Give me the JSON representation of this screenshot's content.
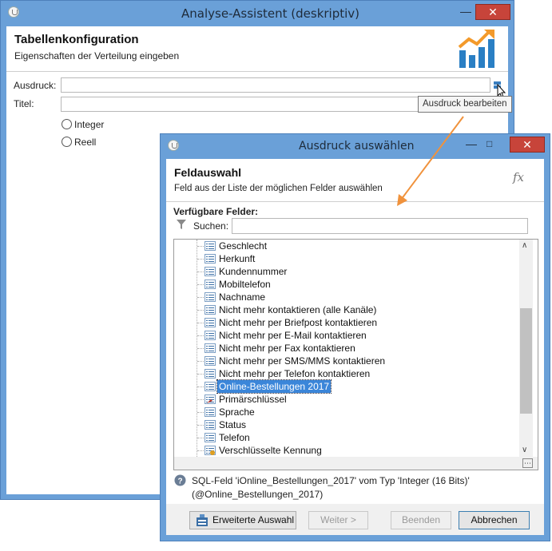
{
  "main_window": {
    "title": "Analyse-Assistent (deskriptiv)",
    "header_title": "Tabellenkonfiguration",
    "header_subtitle": "Eigenschaften der Verteilung eingeben",
    "expression_label": "Ausdruck:",
    "title_label": "Titel:",
    "radio_integer": "Integer",
    "radio_real": "Reell",
    "tooltip": "Ausdruck bearbeiten"
  },
  "dialog": {
    "title": "Ausdruck auswählen",
    "header_title": "Feldauswahl",
    "header_subtitle": "Feld aus der Liste der möglichen Felder auswählen",
    "fx_label": "fx",
    "fields_label": "Verfügbare Felder:",
    "search_label": "Suchen:",
    "search_value": "",
    "tree_items": [
      {
        "label": "Geschlecht",
        "icon": "field-icon"
      },
      {
        "label": "Herkunft",
        "icon": "field-icon"
      },
      {
        "label": "Kundennummer",
        "icon": "field-icon"
      },
      {
        "label": "Mobiltelefon",
        "icon": "field-icon"
      },
      {
        "label": "Nachname",
        "icon": "field-icon"
      },
      {
        "label": "Nicht mehr kontaktieren (alle Kanäle)",
        "icon": "field-icon"
      },
      {
        "label": "Nicht mehr per Briefpost kontaktieren",
        "icon": "field-icon"
      },
      {
        "label": "Nicht mehr per E-Mail kontaktieren",
        "icon": "field-icon"
      },
      {
        "label": "Nicht mehr per Fax kontaktieren",
        "icon": "field-icon"
      },
      {
        "label": "Nicht mehr per SMS/MMS kontaktieren",
        "icon": "field-icon"
      },
      {
        "label": "Nicht mehr per Telefon kontaktieren",
        "icon": "field-icon"
      },
      {
        "label": "Online-Bestellungen 2017",
        "icon": "field-icon",
        "selected": true
      },
      {
        "label": "Primärschlüssel",
        "icon": "primary-key-icon"
      },
      {
        "label": "Sprache",
        "icon": "field-icon"
      },
      {
        "label": "Status",
        "icon": "field-icon"
      },
      {
        "label": "Telefon",
        "icon": "field-icon"
      },
      {
        "label": "Verschlüsselte Kennung",
        "icon": "encrypted-id-icon"
      }
    ],
    "info_line1": "SQL-Feld 'iOnline_Bestellungen_2017' vom Typ 'Integer (16 Bits)'",
    "info_line2": "(@Online_Bestellungen_2017)",
    "buttons": {
      "advanced": "Erweiterte Auswahl",
      "next": "Weiter >",
      "finish": "Beenden",
      "cancel": "Abbrechen"
    }
  },
  "colors": {
    "titlebar": "#6aa0d8",
    "selection": "#3b86d9",
    "close": "#c7443a",
    "arrow": "#f0923c",
    "chart_blue": "#2a7fc4",
    "chart_orange": "#f39a2b"
  }
}
